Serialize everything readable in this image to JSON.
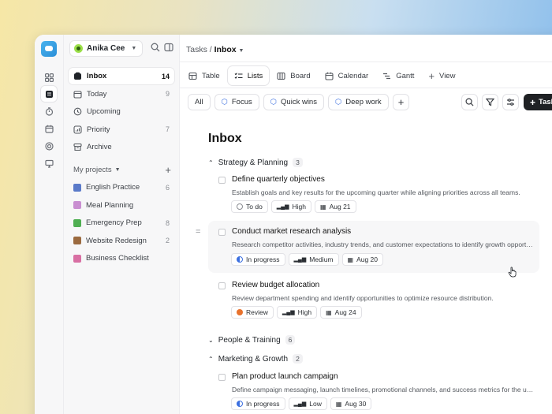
{
  "workspace": {
    "name": "Anika Cee"
  },
  "breadcrumb": {
    "root": "Tasks",
    "separator": "/",
    "current": "Inbox"
  },
  "nav": [
    {
      "label": "Inbox",
      "count": "14",
      "icon": "inbox-icon"
    },
    {
      "label": "Today",
      "count": "9",
      "icon": "calendar-icon"
    },
    {
      "label": "Upcoming",
      "count": "",
      "icon": "clock-icon"
    },
    {
      "label": "Priority",
      "count": "7",
      "icon": "priority-icon"
    },
    {
      "label": "Archive",
      "count": "",
      "icon": "archive-icon"
    }
  ],
  "projects_header": "My projects",
  "projects": [
    {
      "label": "English Practice",
      "count": "6",
      "color": "#5a7ac9"
    },
    {
      "label": "Meal Planning",
      "count": "",
      "color": "#c98fd1"
    },
    {
      "label": "Emergency Prep",
      "count": "8",
      "color": "#4fae52"
    },
    {
      "label": "Website Redesign",
      "count": "2",
      "color": "#9b6a3f"
    },
    {
      "label": "Business Checklist",
      "count": "",
      "color": "#d86fa3"
    }
  ],
  "views": [
    {
      "label": "Table",
      "active": false
    },
    {
      "label": "Lists",
      "active": true
    },
    {
      "label": "Board",
      "active": false
    },
    {
      "label": "Calendar",
      "active": false
    },
    {
      "label": "Gantt",
      "active": false
    },
    {
      "label": "View",
      "active": false
    }
  ],
  "filters": [
    "All",
    "Focus",
    "Quick wins",
    "Deep work"
  ],
  "add_task_label": "Task",
  "page_title": "Inbox",
  "groups": [
    {
      "name": "Strategy & Planning",
      "count": "3"
    },
    {
      "name": "People & Training",
      "count": "6"
    },
    {
      "name": "Marketing & Growth",
      "count": "2"
    }
  ],
  "tasks": [
    {
      "title": "Define quarterly objectives",
      "desc": "Establish goals and key results for the upcoming quarter while aligning priorities across all teams.",
      "status": "To do",
      "priority": "High",
      "date": "Aug 21",
      "status_color": "#8a8d93"
    },
    {
      "title": "Conduct market research analysis",
      "desc": "Research competitor activities, industry trends, and customer expectations to identify growth opportunities...",
      "status": "In progress",
      "priority": "Medium",
      "date": "Aug 20",
      "status_color": "#3b6fe0"
    },
    {
      "title": "Review budget allocation",
      "desc": "Review department spending and identify opportunities to optimize resource distribution.",
      "status": "Review",
      "priority": "High",
      "date": "Aug 24",
      "status_color": "#e8722c"
    },
    {
      "title": "Plan product launch campaign",
      "desc": "Define campaign messaging, launch timelines, promotional channels, and success metrics for the upcoming...",
      "status": "In progress",
      "priority": "Low",
      "date": "Aug 30",
      "status_color": "#3b6fe0"
    }
  ]
}
